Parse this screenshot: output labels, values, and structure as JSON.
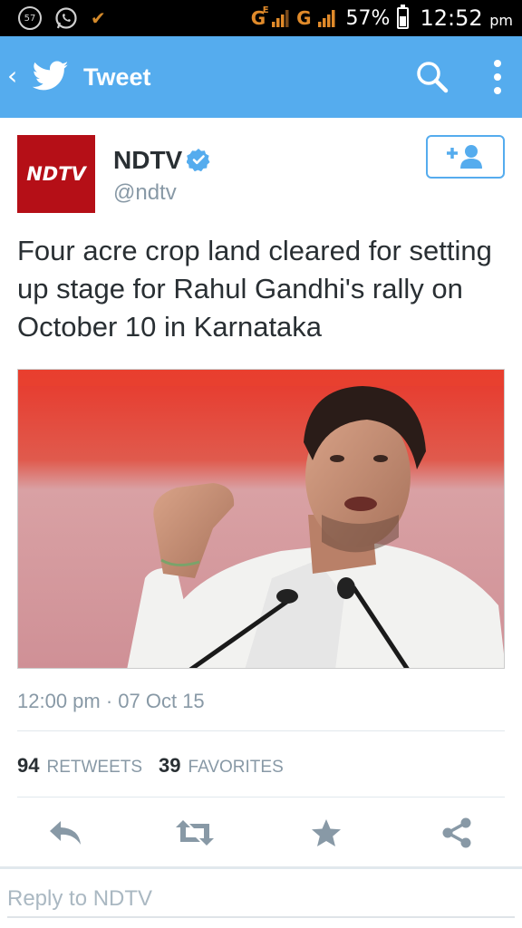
{
  "status_bar": {
    "notification_count": "57",
    "network_1": "G",
    "network_1_sup": "E",
    "network_2": "G",
    "battery": "57%",
    "battery_level": 0.57,
    "time": "12:52",
    "ampm": "pm"
  },
  "app_bar": {
    "title": "Tweet"
  },
  "tweet": {
    "avatar_text": "NDTV",
    "user_name": "NDTV",
    "handle": "@ndtv",
    "text": "Four acre crop land cleared for setting up stage for Rahul Gandhi's rally on October 10 in Karnataka",
    "timestamp": "12:00 pm · 07 Oct 15",
    "retweets_count": "94",
    "retweets_label": "RETWEETS",
    "favorites_count": "39",
    "favorites_label": "FAVORITES"
  },
  "reply": {
    "placeholder": "Reply to NDTV"
  },
  "colors": {
    "twitter_blue": "#55acee",
    "ndtv_red": "#b50f17",
    "icon_gray": "#8899a6"
  }
}
